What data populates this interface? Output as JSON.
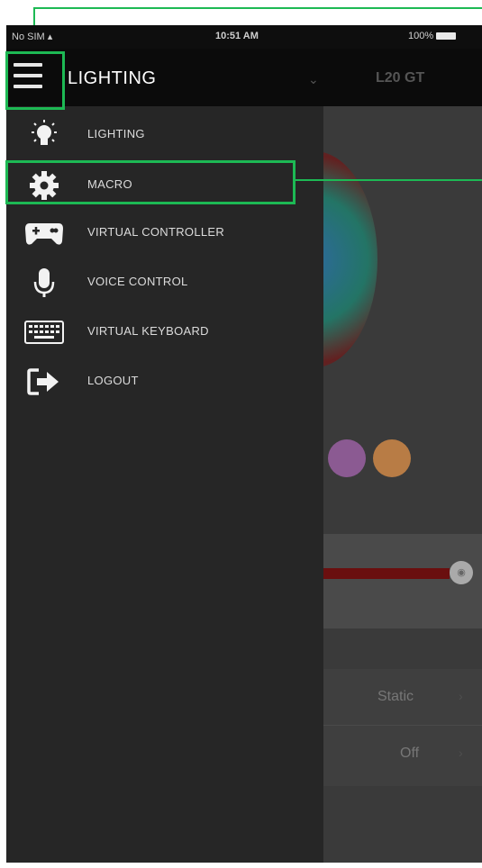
{
  "status": {
    "carrier": "No SIM",
    "time": "10:51 AM",
    "battery": "100%"
  },
  "header": {
    "title": "LIGHTING",
    "device": "L20 GT"
  },
  "menu": {
    "items": [
      {
        "label": "LIGHTING",
        "icon": "lightbulb-icon"
      },
      {
        "label": "MACRO",
        "icon": "gear-icon"
      },
      {
        "label": "VIRTUAL CONTROLLER",
        "icon": "gamepad-icon"
      },
      {
        "label": "VOICE CONTROL",
        "icon": "microphone-icon"
      },
      {
        "label": "VIRTUAL KEYBOARD",
        "icon": "keyboard-icon"
      },
      {
        "label": "LOGOUT",
        "icon": "logout-icon"
      }
    ]
  },
  "background": {
    "mode_value": "Static",
    "state_value": "Off"
  },
  "colors": {
    "highlight": "#1db954",
    "drawer": "#262626",
    "header": "#0b0b0b"
  }
}
